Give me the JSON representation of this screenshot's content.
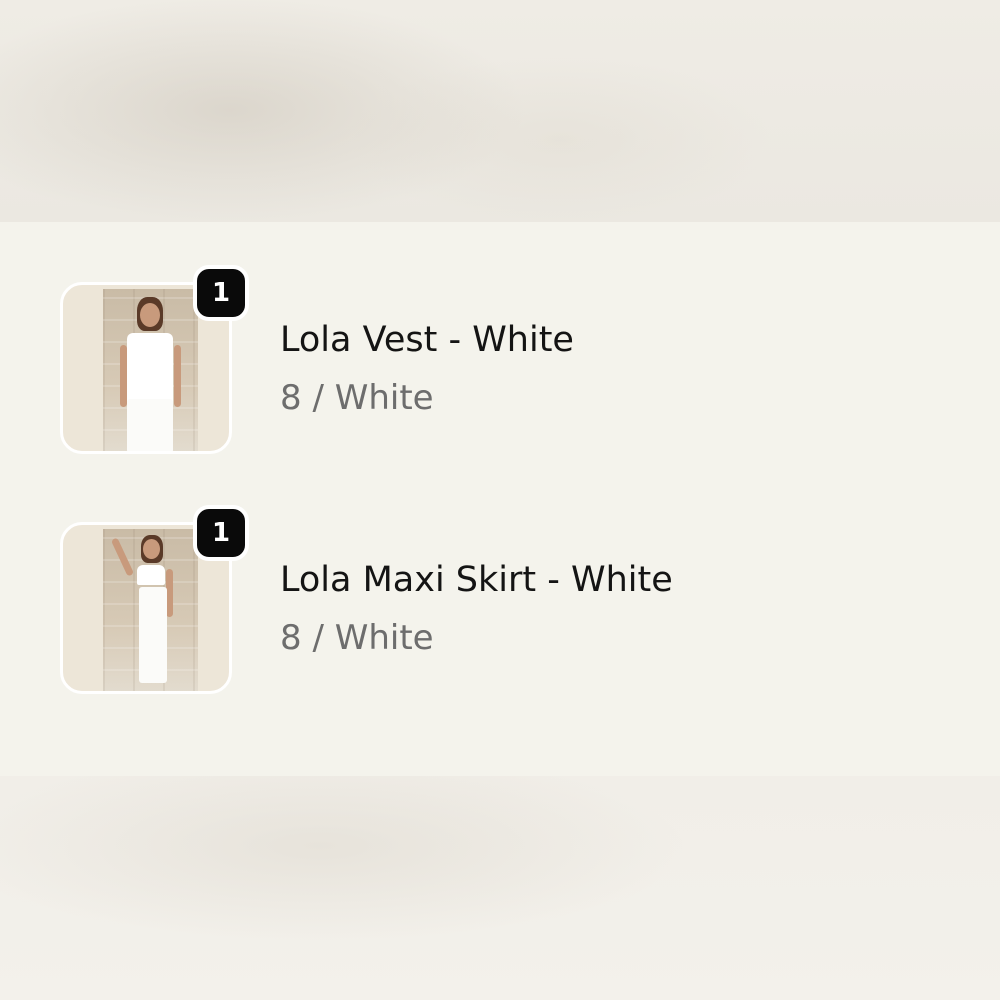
{
  "cart_items": [
    {
      "quantity": "1",
      "title": "Lola Vest - White",
      "variant": "8 / White",
      "thumbnail_icon": "product-photo-vest"
    },
    {
      "quantity": "1",
      "title": "Lola Maxi Skirt - White",
      "variant": "8 / White",
      "thumbnail_icon": "product-photo-skirt"
    }
  ],
  "colors": {
    "panel_background": "#f4f3ec",
    "badge_background": "#0a0a0a",
    "title_text": "#141414",
    "variant_text": "#6d6d6d"
  }
}
